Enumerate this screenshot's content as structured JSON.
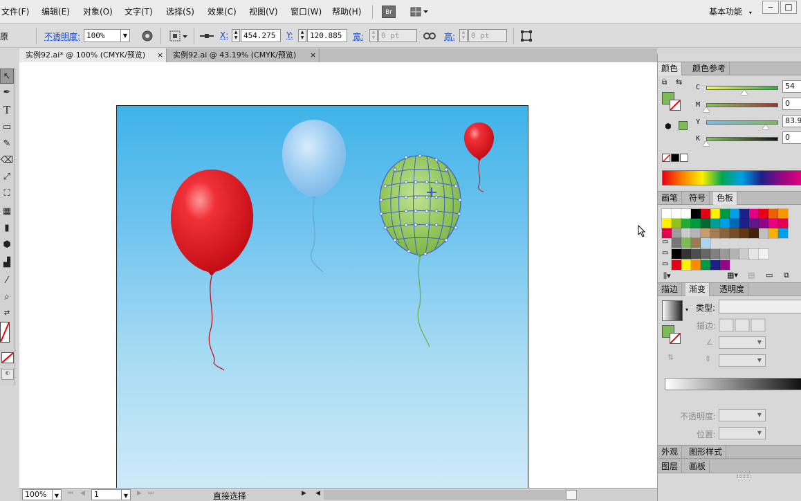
{
  "menu": {
    "items": [
      "文件(F)",
      "编辑(E)",
      "对象(O)",
      "文字(T)",
      "选择(S)",
      "效果(C)",
      "视图(V)",
      "窗口(W)",
      "帮助(H)"
    ],
    "bridge_label": "Br",
    "workspace_label": "基本功能"
  },
  "control": {
    "left_fragment": "原",
    "opacity_label": "不透明度:",
    "opacity_value": "100%",
    "x_label": "X:",
    "x_value": "454.275",
    "y_label": "Y:",
    "y_value": "120.885",
    "w_label": "宽:",
    "w_value": "0 pt",
    "h_label": "高:",
    "h_value": "0 pt"
  },
  "tabs": [
    {
      "label": "实例92.ai* @ 100% (CMYK/预览)"
    },
    {
      "label": "实例92.ai @ 43.19% (CMYK/预览)"
    }
  ],
  "status": {
    "zoom": "100%",
    "page": "1",
    "tool_name": "直接选择"
  },
  "color_panel": {
    "tabs": [
      "颜色",
      "颜色参考"
    ],
    "channels": [
      {
        "label": "C",
        "value": "54",
        "position": 0.54,
        "track": "linear-gradient(90deg,#f8f25c,#36a84c)"
      },
      {
        "label": "M",
        "value": "0",
        "position": 0.0,
        "track": "linear-gradient(90deg,#86c35d,#9c3530)"
      },
      {
        "label": "Y",
        "value": "83.9",
        "position": 0.839,
        "track": "linear-gradient(90deg,#77b9ea,#7cb959)"
      },
      {
        "label": "K",
        "value": "0",
        "position": 0.0,
        "track": "linear-gradient(90deg,#86c35d,#111)"
      }
    ],
    "fill_color": "#7dbb57"
  },
  "swatch_panel": {
    "tabs": [
      "画笔",
      "符号",
      "色板"
    ],
    "rows": [
      [
        "#fff",
        "#fff",
        "#fff",
        "#000",
        "#e60012",
        "#fff100",
        "#009944",
        "#00a0e9",
        "#1d2088",
        "#e4007f",
        "#e60012",
        "#eb6100",
        "#f39800"
      ],
      [
        "#fff100",
        "#8fc31f",
        "#22ac38",
        "#009944",
        "#006934",
        "#009e96",
        "#00a0e9",
        "#0068b7",
        "#1d2088",
        "#601986",
        "#920783",
        "#e4007f",
        "#e5004f"
      ],
      [
        "#e5004f",
        "#9e9e9e",
        "#c9caca",
        "#b5b5b6",
        "#c69c6d",
        "#a67c52",
        "#8c6239",
        "#754c24",
        "#603813",
        "#42210b",
        "#c0c0c0",
        "#f5b200",
        "#00a0e9"
      ],
      [
        "#777",
        "#7dbb57",
        "#9b7b52",
        "#a9d5f0"
      ],
      [
        "#000",
        "#333",
        "#4d4d4d",
        "#666",
        "#808080",
        "#999",
        "#b3b3b3",
        "#ccc",
        "#e6e6e6",
        "#f2f2f2"
      ],
      [
        "#e60012",
        "#fff100",
        "#ff8c00",
        "#009944",
        "#1d2088",
        "#920783"
      ]
    ]
  },
  "gradient_panel": {
    "tabs": [
      "描边",
      "渐变",
      "透明度"
    ],
    "type_label": "类型:",
    "stroke_label": "描边:",
    "opacity_label": "不透明度:",
    "position_label": "位置:"
  },
  "appearance_panel": {
    "tabs": [
      "外观",
      "图形样式"
    ]
  },
  "layers_panel": {
    "tabs": [
      "图层",
      "画板"
    ]
  },
  "colors": {
    "accent": "#1b49b8",
    "red_balloon": "#e3141c",
    "blue_balloon": "#8ec6ef",
    "green_balloon": "#8cc152"
  }
}
